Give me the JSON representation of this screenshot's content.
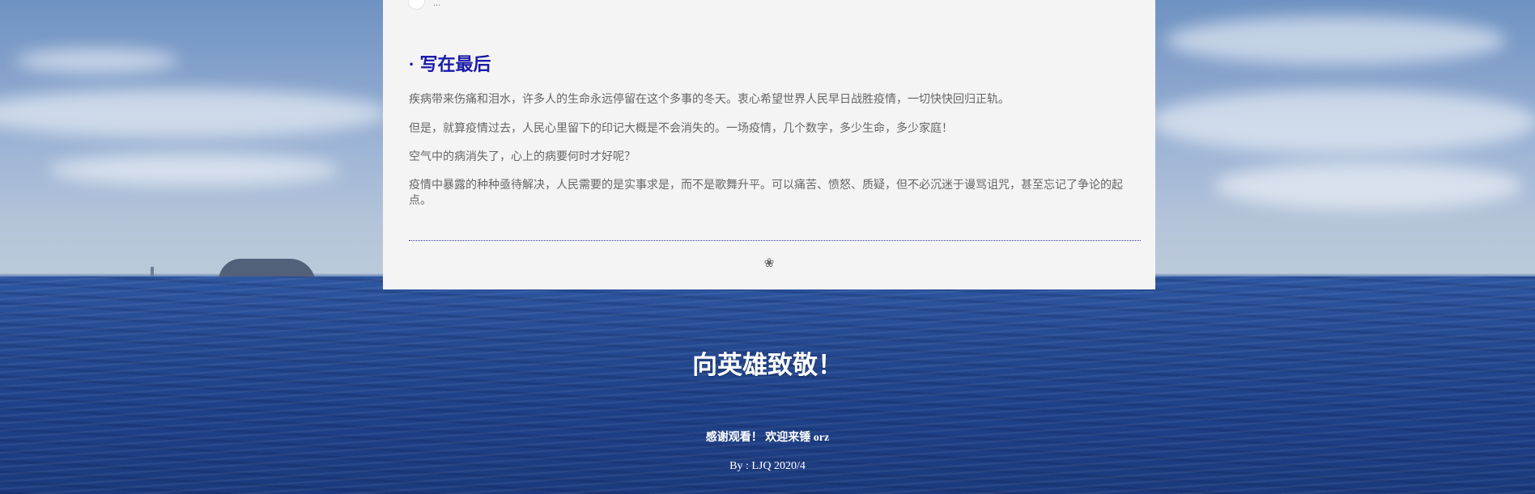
{
  "author_row": {
    "name_text": "..."
  },
  "article": {
    "section_title": "· 写在最后",
    "paragraphs": [
      "疾病带来伤痛和泪水，许多人的生命永远停留在这个多事的冬天。衷心希望世界人民早日战胜疫情，一切快快回归正轨。",
      "但是，就算疫情过去，人民心里留下的印记大概是不会消失的。一场疫情，几个数字，多少生命，多少家庭！",
      "空气中的病消失了，心上的病要何时才好呢？",
      "疫情中暴露的种种亟待解决，人民需要的是实事求是，而不是歌舞升平。可以痛苦、愤怒、质疑，但不必沉迷于谩骂诅咒，甚至忘记了争论的起点。"
    ],
    "end_ornament": "❀"
  },
  "footer": {
    "tribute": "向英雄致敬！",
    "thanks": "感谢观看！ 欢迎来锤 orz",
    "byline": "By : LJQ 2020/4"
  },
  "colors": {
    "card_background": "#f4f4f4",
    "title_color": "#1a1aa8",
    "body_text": "#666666",
    "footer_text": "#ffffff"
  }
}
